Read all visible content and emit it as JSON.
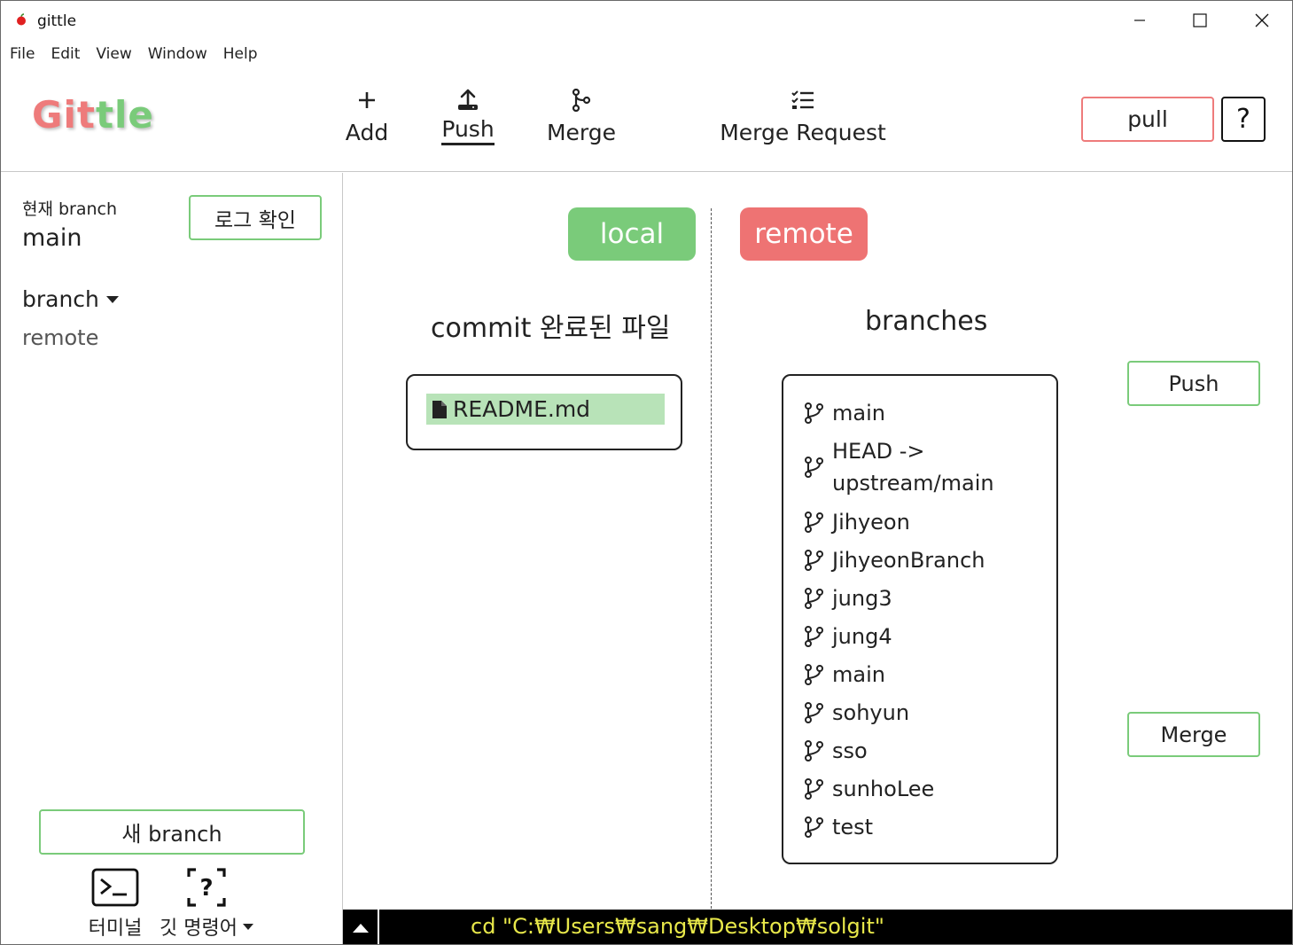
{
  "window": {
    "title": "gittle"
  },
  "menu": [
    "File",
    "Edit",
    "View",
    "Window",
    "Help"
  ],
  "toolbar": {
    "logo_part1": "Git",
    "logo_part2": "tle",
    "add_label": "Add",
    "push_label": "Push",
    "merge_label": "Merge",
    "merge_request_label": "Merge Request",
    "pull_label": "pull",
    "help_label": "?"
  },
  "sidebar": {
    "current_branch_label": "현재 branch",
    "current_branch_value": "main",
    "log_button": "로그 확인",
    "branch_dropdown": "branch",
    "remote_item": "remote",
    "new_branch_button": "새 branch",
    "terminal_label": "터미널",
    "git_commands_label": "깃 명령어"
  },
  "main": {
    "local_pill": "local",
    "remote_pill": "remote",
    "commit_title": "commit 완료된 파일",
    "branches_title": "branches",
    "files": [
      "README.md"
    ],
    "branches": [
      "main",
      "HEAD -> upstream/main",
      "Jihyeon",
      "JihyeonBranch",
      "jung3",
      "jung4",
      "main",
      "sohyun",
      "sso",
      "sunhoLee",
      "test"
    ],
    "push_button": "Push",
    "merge_button": "Merge"
  },
  "terminal": {
    "command": "cd \"C:₩Users₩sang₩Desktop₩solgit\""
  },
  "colors": {
    "accent_green": "#7acb7a",
    "accent_red": "#ee7373",
    "file_highlight": "#b8e3b8",
    "terminal_text": "#e8e84a"
  }
}
